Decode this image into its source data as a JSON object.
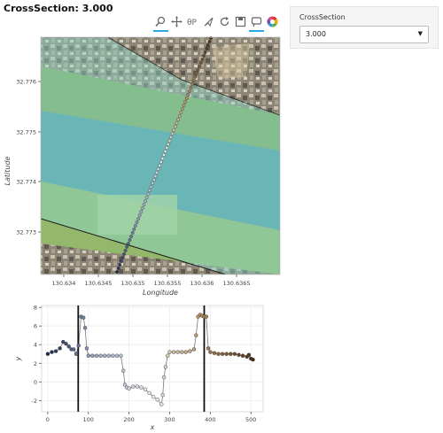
{
  "title": "CrossSection: 3.000",
  "toolbar": {
    "tools": [
      {
        "name": "box-zoom-tool",
        "active": true
      },
      {
        "name": "pan-tool",
        "active": false
      },
      {
        "name": "wheel-zoom-tool",
        "active": false
      },
      {
        "name": "tap-tool",
        "active": false
      },
      {
        "name": "reset-tool",
        "active": false
      },
      {
        "name": "save-tool",
        "active": false
      },
      {
        "name": "hover-tool",
        "active": true
      },
      {
        "name": "bokeh-logo",
        "active": false
      }
    ],
    "accent": "#26aae1"
  },
  "widget": {
    "label": "CrossSection",
    "selected": "3.000"
  },
  "map_plot": {
    "xlabel": "Longitude",
    "ylabel": "Latitude",
    "x_ticks": [
      "130.634",
      "130.6345",
      "130.635",
      "130.6355",
      "130.636",
      "130.6365"
    ],
    "y_ticks": [
      "32.776",
      "32.775",
      "32.774",
      "32.773"
    ],
    "water_color": "#4e9aa6",
    "polygon_color": "#8fd9cc"
  },
  "chart_data": {
    "type": "scatter",
    "xlabel": "x",
    "ylabel": "y",
    "xlim": [
      -15,
      530
    ],
    "ylim": [
      -3.2,
      8.2
    ],
    "grid": true,
    "x_ticks": [
      "0",
      "100",
      "200",
      "300",
      "400",
      "500"
    ],
    "y_ticks": [
      "8",
      "6",
      "4",
      "2",
      "0",
      "-2"
    ],
    "vlines": [
      75,
      385
    ],
    "x": [
      0,
      10,
      20,
      30,
      38,
      45,
      52,
      58,
      64,
      70,
      76,
      82,
      88,
      92,
      96,
      100,
      110,
      120,
      130,
      140,
      150,
      160,
      170,
      180,
      186,
      190,
      195,
      200,
      210,
      220,
      230,
      240,
      250,
      260,
      270,
      280,
      283,
      286,
      290,
      295,
      300,
      310,
      320,
      330,
      340,
      350,
      360,
      365,
      370,
      375,
      380,
      385,
      390,
      395,
      400,
      410,
      420,
      430,
      440,
      450,
      460,
      470,
      480,
      490,
      495,
      500,
      505
    ],
    "y": [
      3.0,
      3.2,
      3.3,
      3.6,
      4.3,
      4.1,
      3.8,
      3.5,
      3.5,
      3.0,
      3.9,
      7.0,
      6.9,
      5.8,
      3.6,
      2.8,
      2.8,
      2.8,
      2.8,
      2.8,
      2.8,
      2.8,
      2.8,
      2.8,
      1.2,
      -0.3,
      -0.6,
      -0.7,
      -0.5,
      -0.5,
      -0.6,
      -0.8,
      -1.2,
      -1.6,
      -1.9,
      -2.4,
      -1.4,
      0.5,
      1.6,
      2.8,
      3.2,
      3.2,
      3.2,
      3.2,
      3.2,
      3.3,
      3.5,
      5.0,
      7.0,
      7.2,
      7.1,
      7.0,
      7.0,
      3.6,
      3.2,
      3.1,
      3.0,
      3.0,
      3.0,
      3.0,
      3.0,
      2.9,
      2.8,
      2.7,
      2.9,
      2.5,
      2.4
    ]
  }
}
